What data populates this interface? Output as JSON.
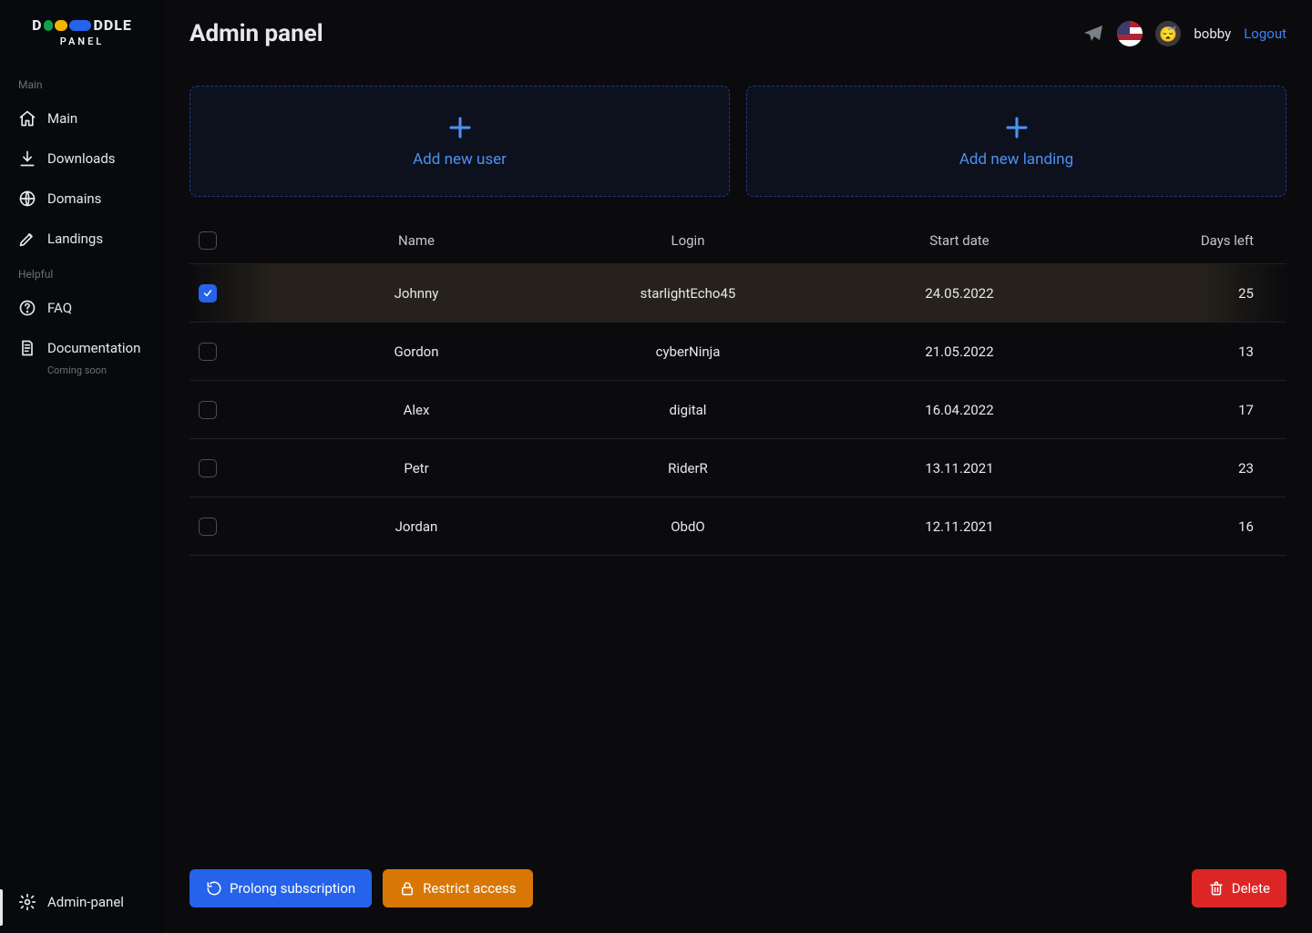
{
  "brand": {
    "word": "DDLE",
    "sub": "PANEL"
  },
  "page_title": "Admin panel",
  "header": {
    "username": "bobby",
    "logout": "Logout"
  },
  "sidebar": {
    "section_main": "Main",
    "section_helpful": "Helpful",
    "items_main": [
      {
        "label": "Main",
        "icon": "home"
      },
      {
        "label": "Downloads",
        "icon": "download"
      },
      {
        "label": "Domains",
        "icon": "globe"
      },
      {
        "label": "Landings",
        "icon": "pen"
      }
    ],
    "items_helpful": [
      {
        "label": "FAQ",
        "icon": "question"
      },
      {
        "label": "Documentation",
        "icon": "doc",
        "sub": "Coming soon"
      }
    ],
    "admin": {
      "label": "Admin-panel",
      "icon": "gear"
    }
  },
  "tiles": {
    "add_user": "Add new user",
    "add_landing": "Add new landing"
  },
  "table": {
    "headers": {
      "name": "Name",
      "login": "Login",
      "start": "Start date",
      "days": "Days left"
    },
    "rows": [
      {
        "checked": true,
        "name": "Johnny",
        "login": "starlightEcho45",
        "start": "24.05.2022",
        "days": "25"
      },
      {
        "checked": false,
        "name": "Gordon",
        "login": "cyberNinja",
        "start": "21.05.2022",
        "days": "13"
      },
      {
        "checked": false,
        "name": "Alex",
        "login": "digital",
        "start": "16.04.2022",
        "days": "17"
      },
      {
        "checked": false,
        "name": "Petr",
        "login": "RiderR",
        "start": "13.11.2021",
        "days": "23"
      },
      {
        "checked": false,
        "name": "Jordan",
        "login": "ObdO",
        "start": "12.11.2021",
        "days": "16"
      }
    ]
  },
  "actions": {
    "prolong": "Prolong subscription",
    "restrict": "Restrict access",
    "delete": "Delete"
  }
}
